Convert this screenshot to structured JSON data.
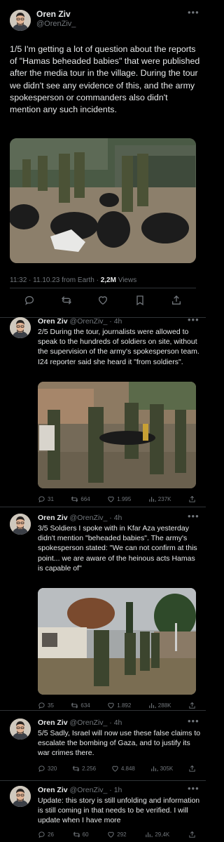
{
  "main_tweet": {
    "name": "Oren Ziv",
    "handle": "@OrenZiv_",
    "text": "1/5 I'm getting a lot of question about the reports of \"Hamas beheaded babies\" that were published after the media tour in the village. During the tour we didn't see any evidence of this, and the army spokesperson or commanders also didn't mention any such incidents.",
    "time_meta": "11:32 · 11.10.23 from Earth · ",
    "views_count": "2,2M",
    "views_label": " Views"
  },
  "replies": [
    {
      "name": "Oren Ziv",
      "handle": "@OrenZiv_",
      "age": "· 4h",
      "text": "2/5 During the tour, journalists were allowed to speak to the hundreds of soldiers on site, without the supervision of the army's spokesperson team. I24 reporter said she heard it \"from soldiers\".",
      "stats": {
        "replies": "31",
        "reposts": "664",
        "likes": "1.995",
        "views": "237K"
      }
    },
    {
      "name": "Oren Ziv",
      "handle": "@OrenZiv_",
      "age": "· 4h",
      "text": "3/5 Soldiers I spoke with in Kfar Aza yesterday didn't mention \"beheaded babies\". The army's spokesperson stated: \"We can not confirm at this point... we are aware of the heinous acts Hamas is capable of\"",
      "stats": {
        "replies": "35",
        "reposts": "634",
        "likes": "1.892",
        "views": "288K"
      }
    },
    {
      "name": "Oren Ziv",
      "handle": "@OrenZiv_",
      "age": "· 4h",
      "text": "5/5 Sadly, Israel will now use these false claims to escalate the bombing of Gaza, and to justify its war crimes there.",
      "stats": {
        "replies": "320",
        "reposts": "2.256",
        "likes": "4.848",
        "views": "305K"
      }
    },
    {
      "name": "Oren Ziv",
      "handle": "@OrenZiv_",
      "age": "· 1h",
      "text": "Update: this story is still unfolding and information is still coming in that needs to be verified. I will update when I have more",
      "stats": {
        "replies": "26",
        "reposts": "60",
        "likes": "292",
        "views": "29,4K"
      }
    }
  ],
  "colors": {
    "background": "#000000",
    "text": "#e7e9ea",
    "muted": "#71767b",
    "separator": "#2f3336"
  },
  "icons": [
    "avatar",
    "more-icon",
    "reply-icon",
    "repost-icon",
    "like-icon",
    "bookmark-icon",
    "share-icon",
    "views-icon"
  ]
}
